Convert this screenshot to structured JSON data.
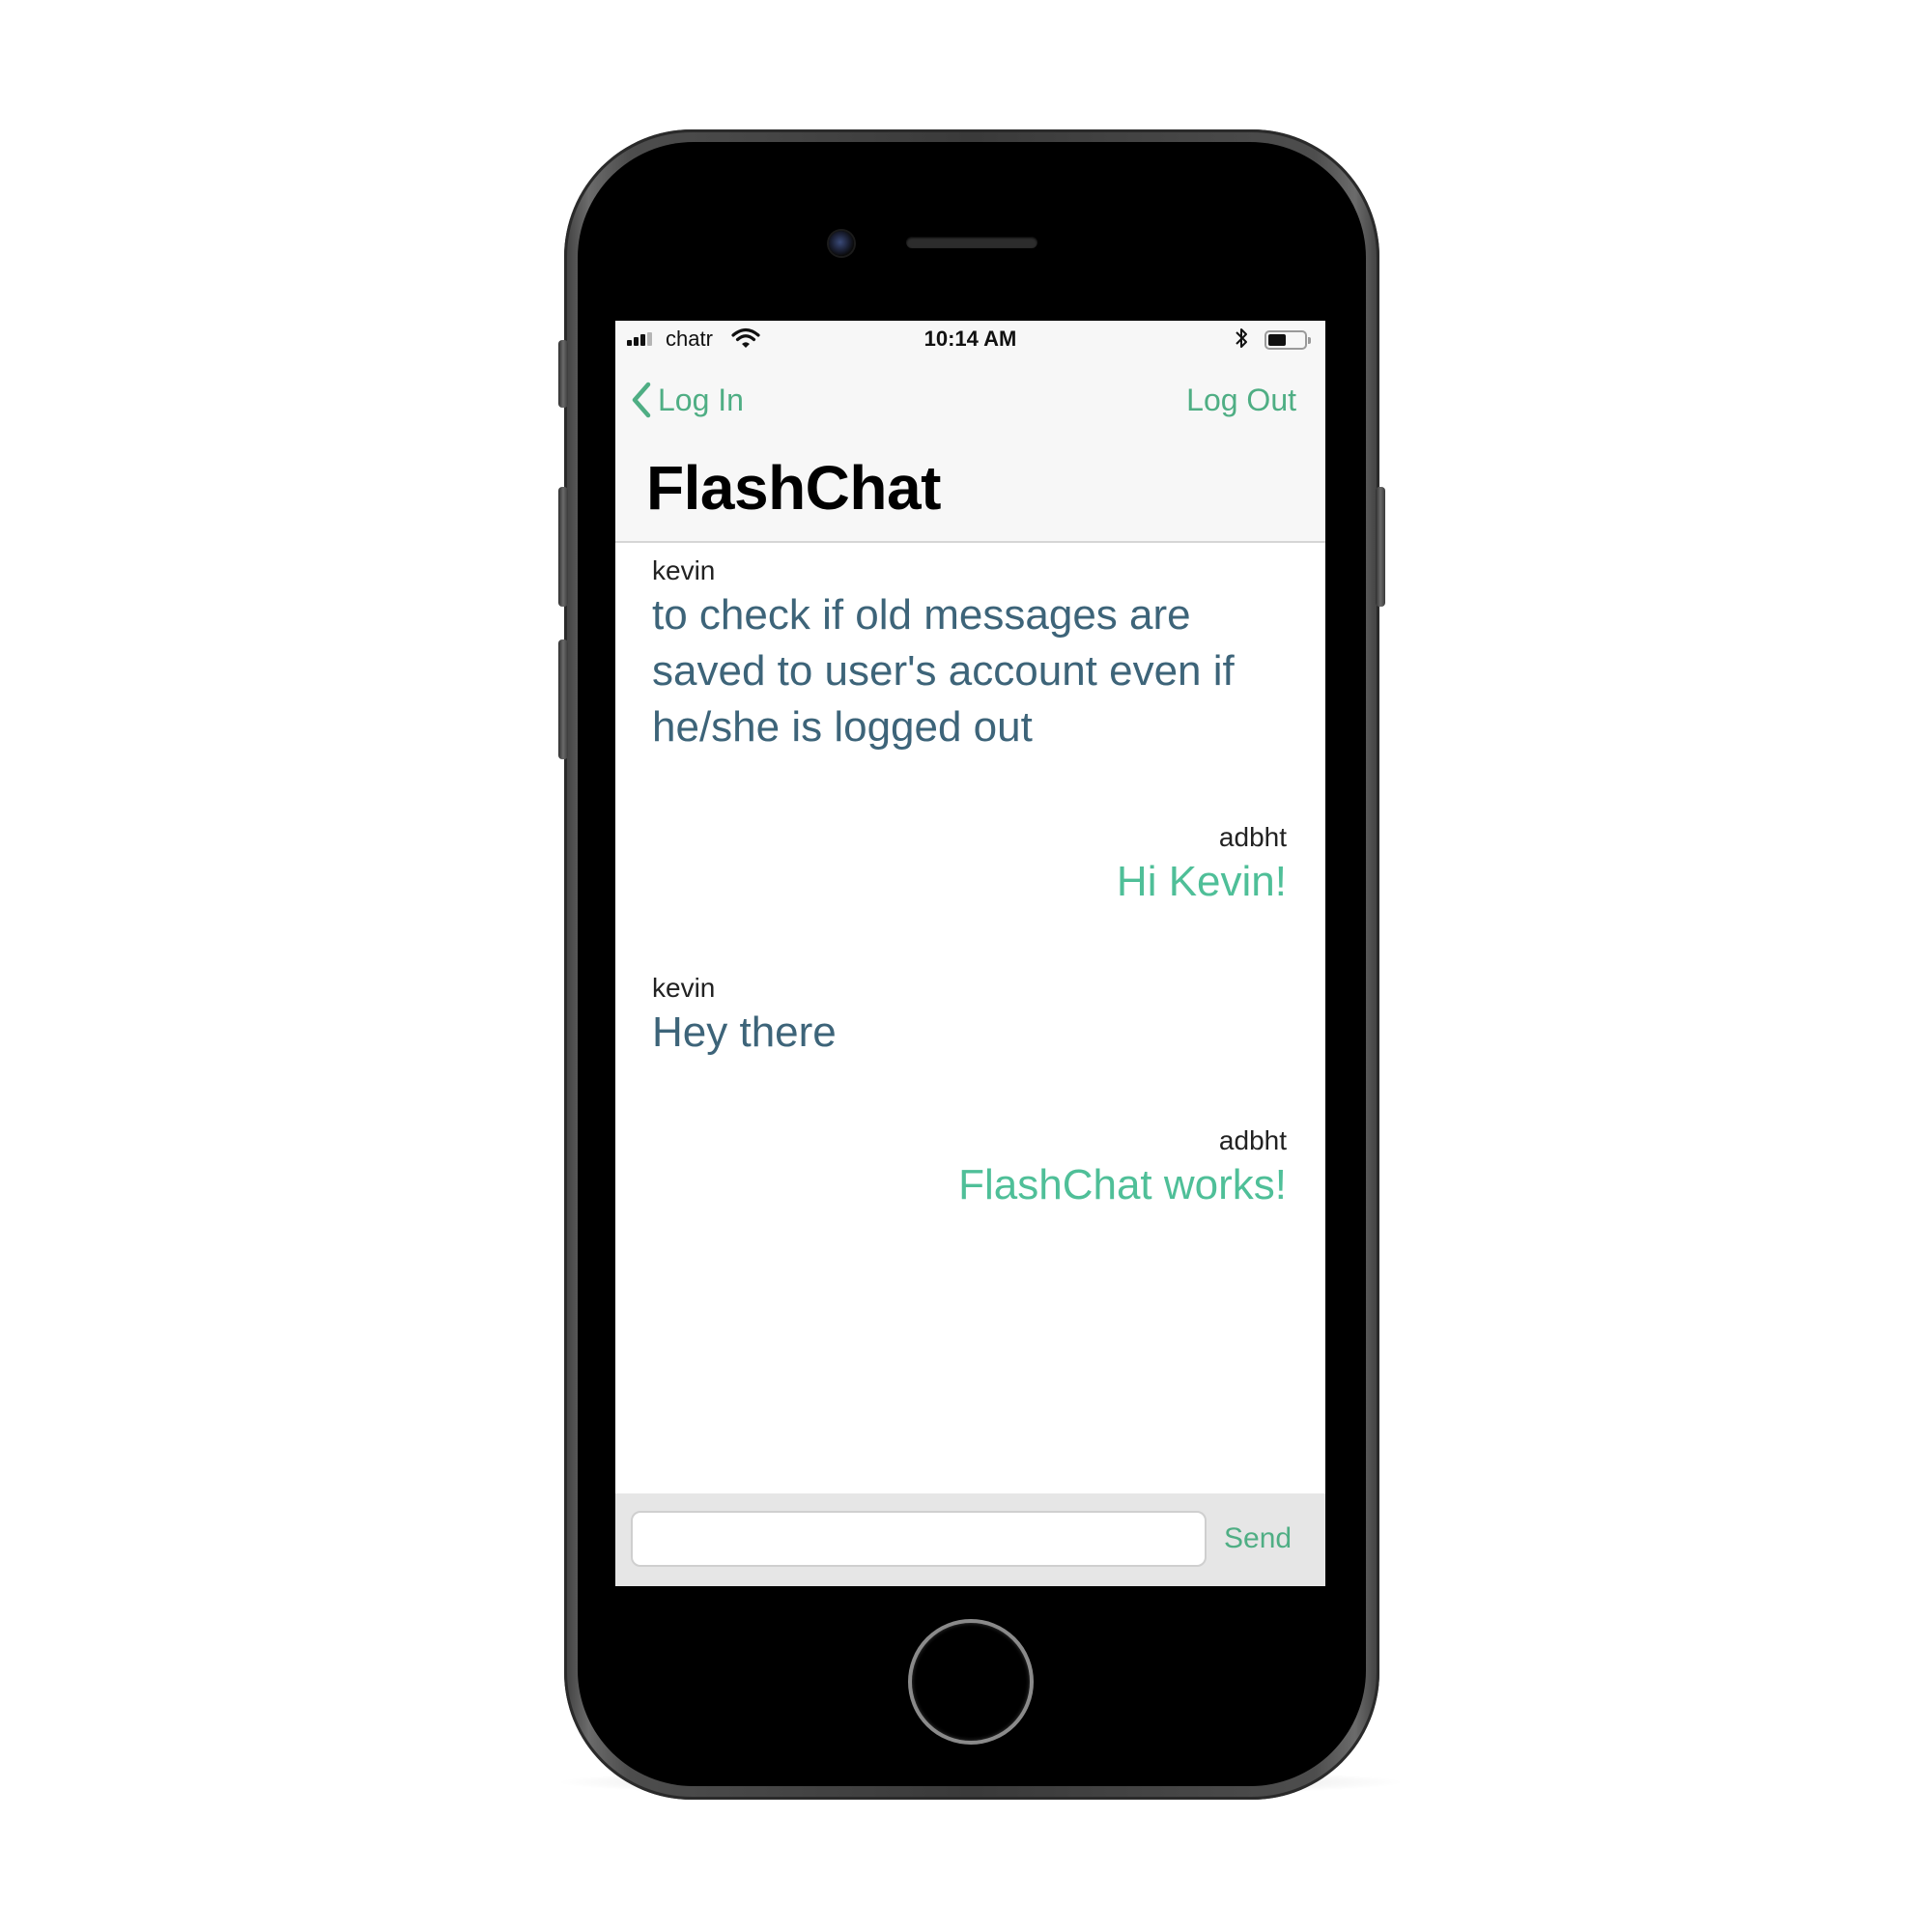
{
  "status_bar": {
    "carrier": "chatr",
    "time": "10:14 AM",
    "battery_level": 0.5,
    "signal_bars": 3
  },
  "nav": {
    "back_label": "Log In",
    "logout_label": "Log Out",
    "title": "FlashChat"
  },
  "messages": [
    {
      "sender": "kevin",
      "text": "to check if old messages are saved to user's account even if he/she is logged out",
      "side": "left"
    },
    {
      "sender": "adbht",
      "text": "Hi Kevin!",
      "side": "right"
    },
    {
      "sender": "kevin",
      "text": "Hey there",
      "side": "left"
    },
    {
      "sender": "adbht",
      "text": "FlashChat works!",
      "side": "right"
    }
  ],
  "compose": {
    "input_value": "",
    "send_label": "Send"
  },
  "colors": {
    "accent": "#4fae84",
    "incoming_text": "#3d6479",
    "outgoing_text": "#4fbf98"
  },
  "icons": [
    "signal-icon",
    "wifi-icon",
    "bluetooth-icon",
    "battery-icon",
    "chevron-left-icon",
    "camera-icon",
    "speaker-icon",
    "home-button"
  ]
}
